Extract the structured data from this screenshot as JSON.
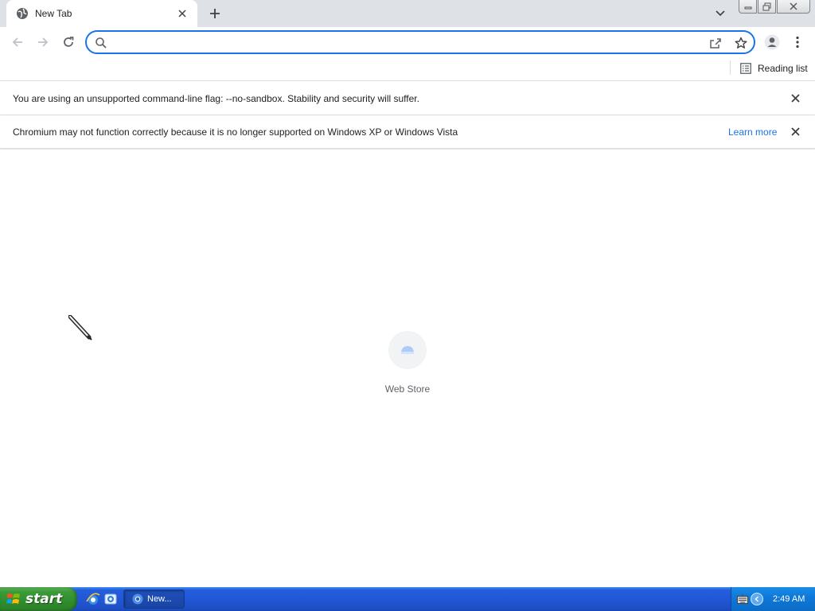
{
  "window": {
    "tab_title": "New Tab",
    "controls": {
      "minimize": "minimize-icon",
      "maximize": "restore-icon",
      "close": "close-icon"
    }
  },
  "toolbar": {
    "omnibox_value": "",
    "omnibox_placeholder": ""
  },
  "bookmarks": {
    "reading_list_label": "Reading list"
  },
  "infobars": [
    {
      "message": "You are using an unsupported command-line flag: --no-sandbox. Stability and security will suffer."
    },
    {
      "message": "Chromium may not function correctly because it is no longer supported on Windows XP or Windows Vista",
      "link": "Learn more"
    }
  ],
  "content": {
    "shortcut_label": "Web Store"
  },
  "taskbar": {
    "start_label": "start",
    "task_label": "New...",
    "clock": "2:49 AM"
  },
  "colors": {
    "accent": "#1a73e8",
    "tabstrip": "#dee1e6",
    "xp_taskbar": "#245edb",
    "xp_start": "#3b9b38"
  }
}
